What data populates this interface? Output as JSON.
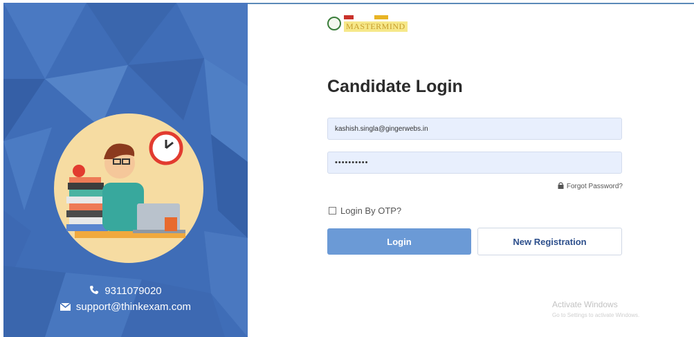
{
  "branding": {
    "logo_text": "MASTERMIND",
    "colors": {
      "panel": "#3f6db7",
      "button": "#6b9ad6",
      "accent": "#2d4f8c"
    }
  },
  "login": {
    "title": "Candidate Login",
    "email_value": "kashish.singla@gingerwebs.in",
    "password_value": "••••••••••",
    "forgot_password_label": "Forgot Password?",
    "otp_label": "Login By OTP?",
    "login_button_label": "Login",
    "register_button_label": "New Registration"
  },
  "contact": {
    "phone": "9311079020",
    "email": "support@thinkexam.com"
  },
  "watermark": {
    "title": "Activate Windows",
    "subtitle": "Go to Settings to activate Windows."
  }
}
